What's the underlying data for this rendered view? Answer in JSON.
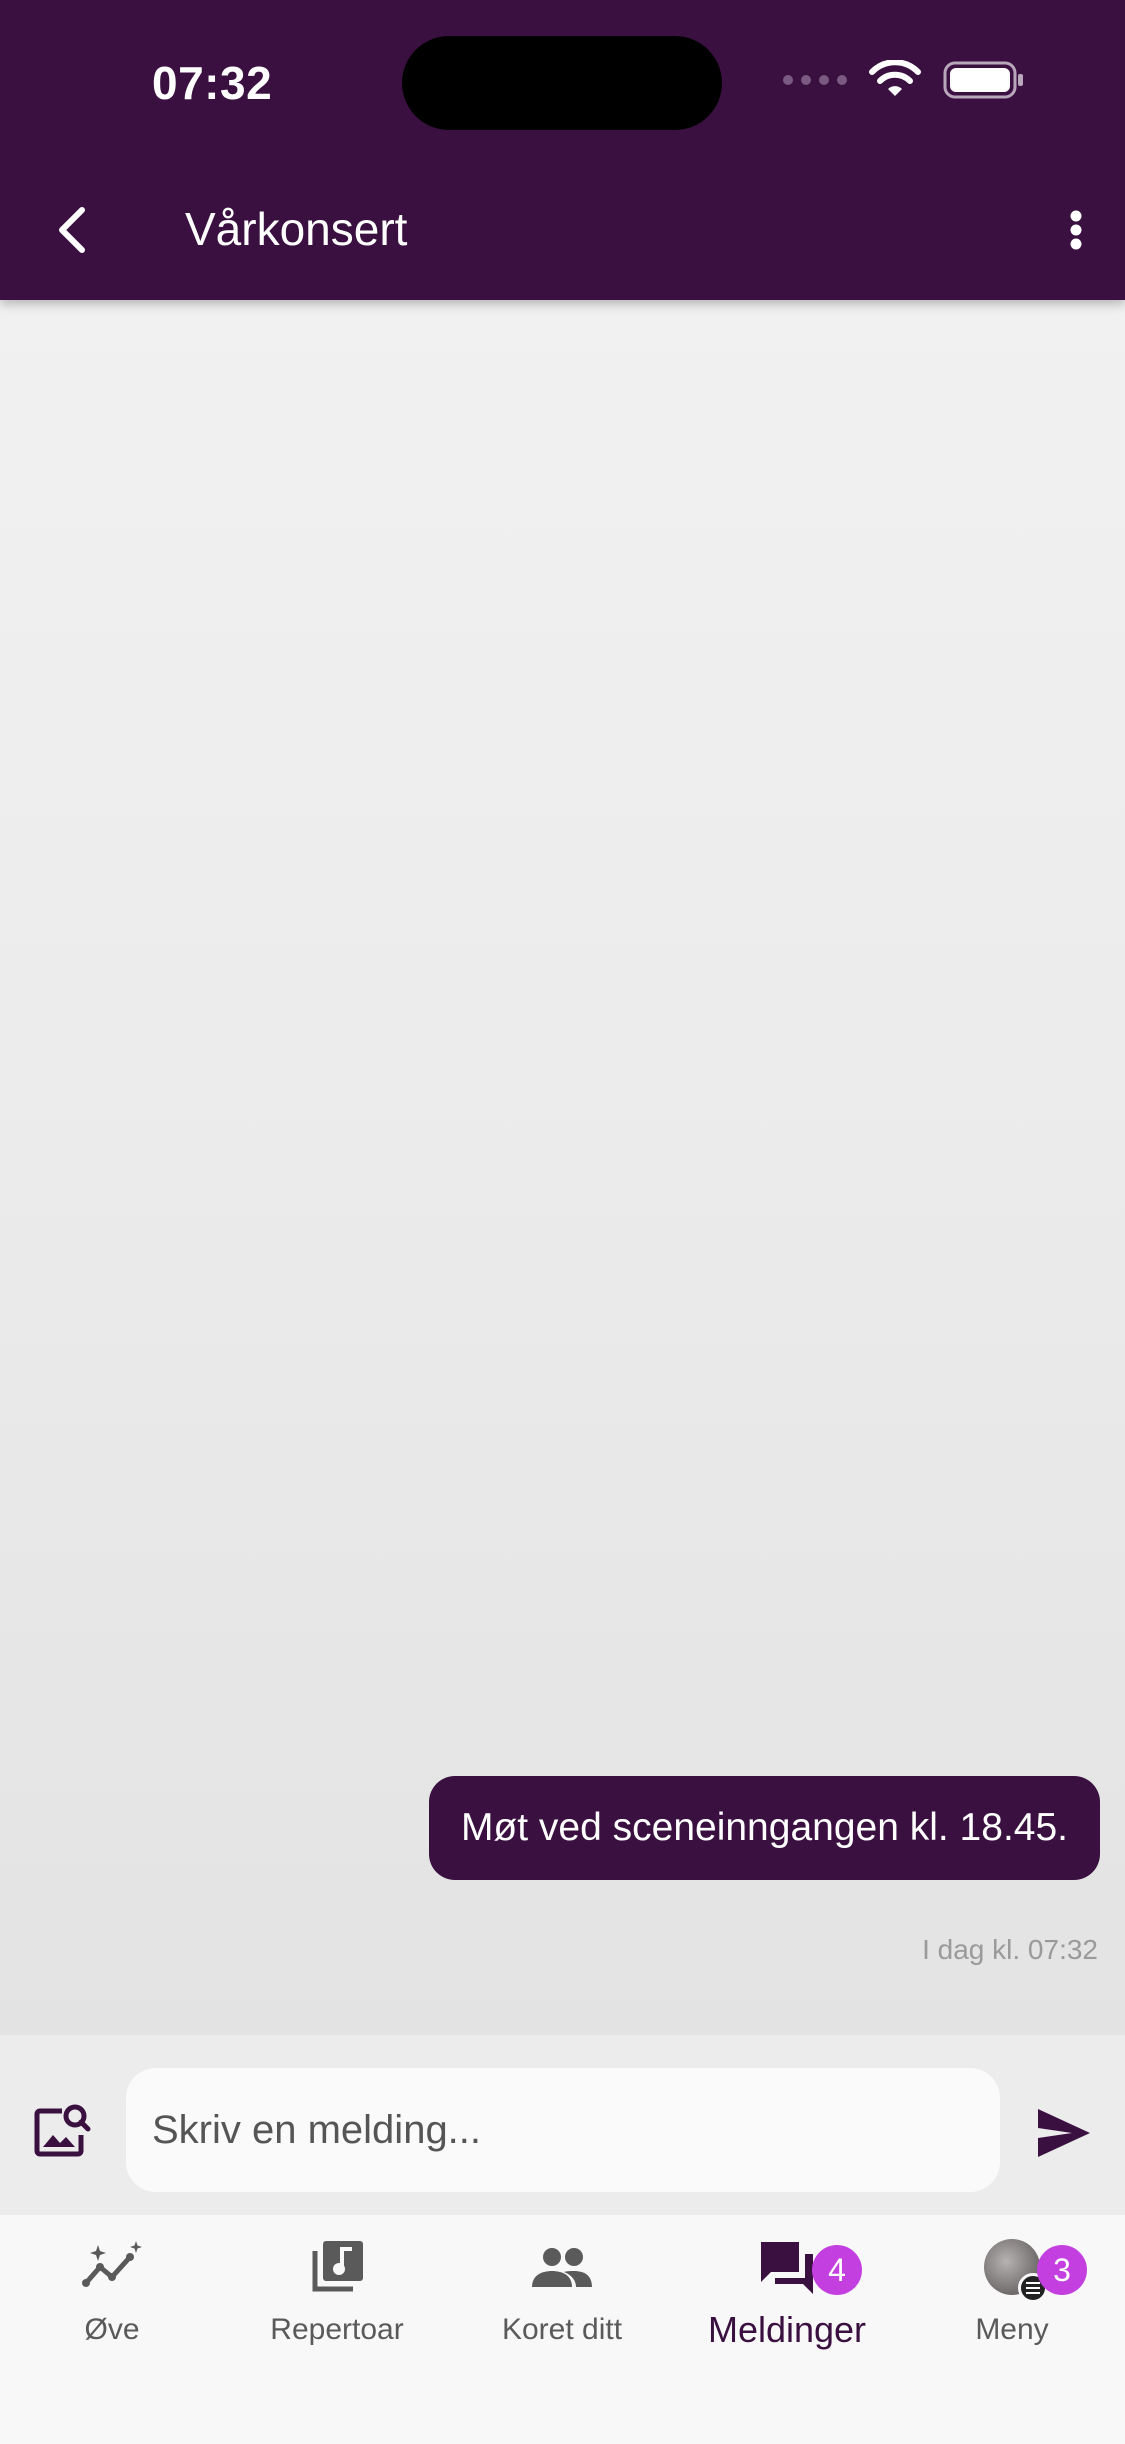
{
  "status_bar": {
    "time": "07:32"
  },
  "header": {
    "title": "Vårkonsert"
  },
  "messages": [
    {
      "text": "Møt ved sceneinngangen kl. 18.45.",
      "timestamp": "I dag kl. 07:32"
    }
  ],
  "composer": {
    "placeholder": "Skriv en melding...",
    "value": ""
  },
  "nav": {
    "items": [
      {
        "label": "Øve",
        "icon": "practice-sparkle-chart-icon"
      },
      {
        "label": "Repertoar",
        "icon": "music-library-icon"
      },
      {
        "label": "Koret ditt",
        "icon": "people-group-icon"
      },
      {
        "label": "Meldinger",
        "icon": "chat-bubbles-icon",
        "badge": "4",
        "active": true
      },
      {
        "label": "Meny",
        "icon": "avatar-menu-icon",
        "badge": "3"
      }
    ]
  },
  "colors": {
    "brand": "#3a1040",
    "badge": "#c43fe0",
    "background": "#ececec"
  }
}
